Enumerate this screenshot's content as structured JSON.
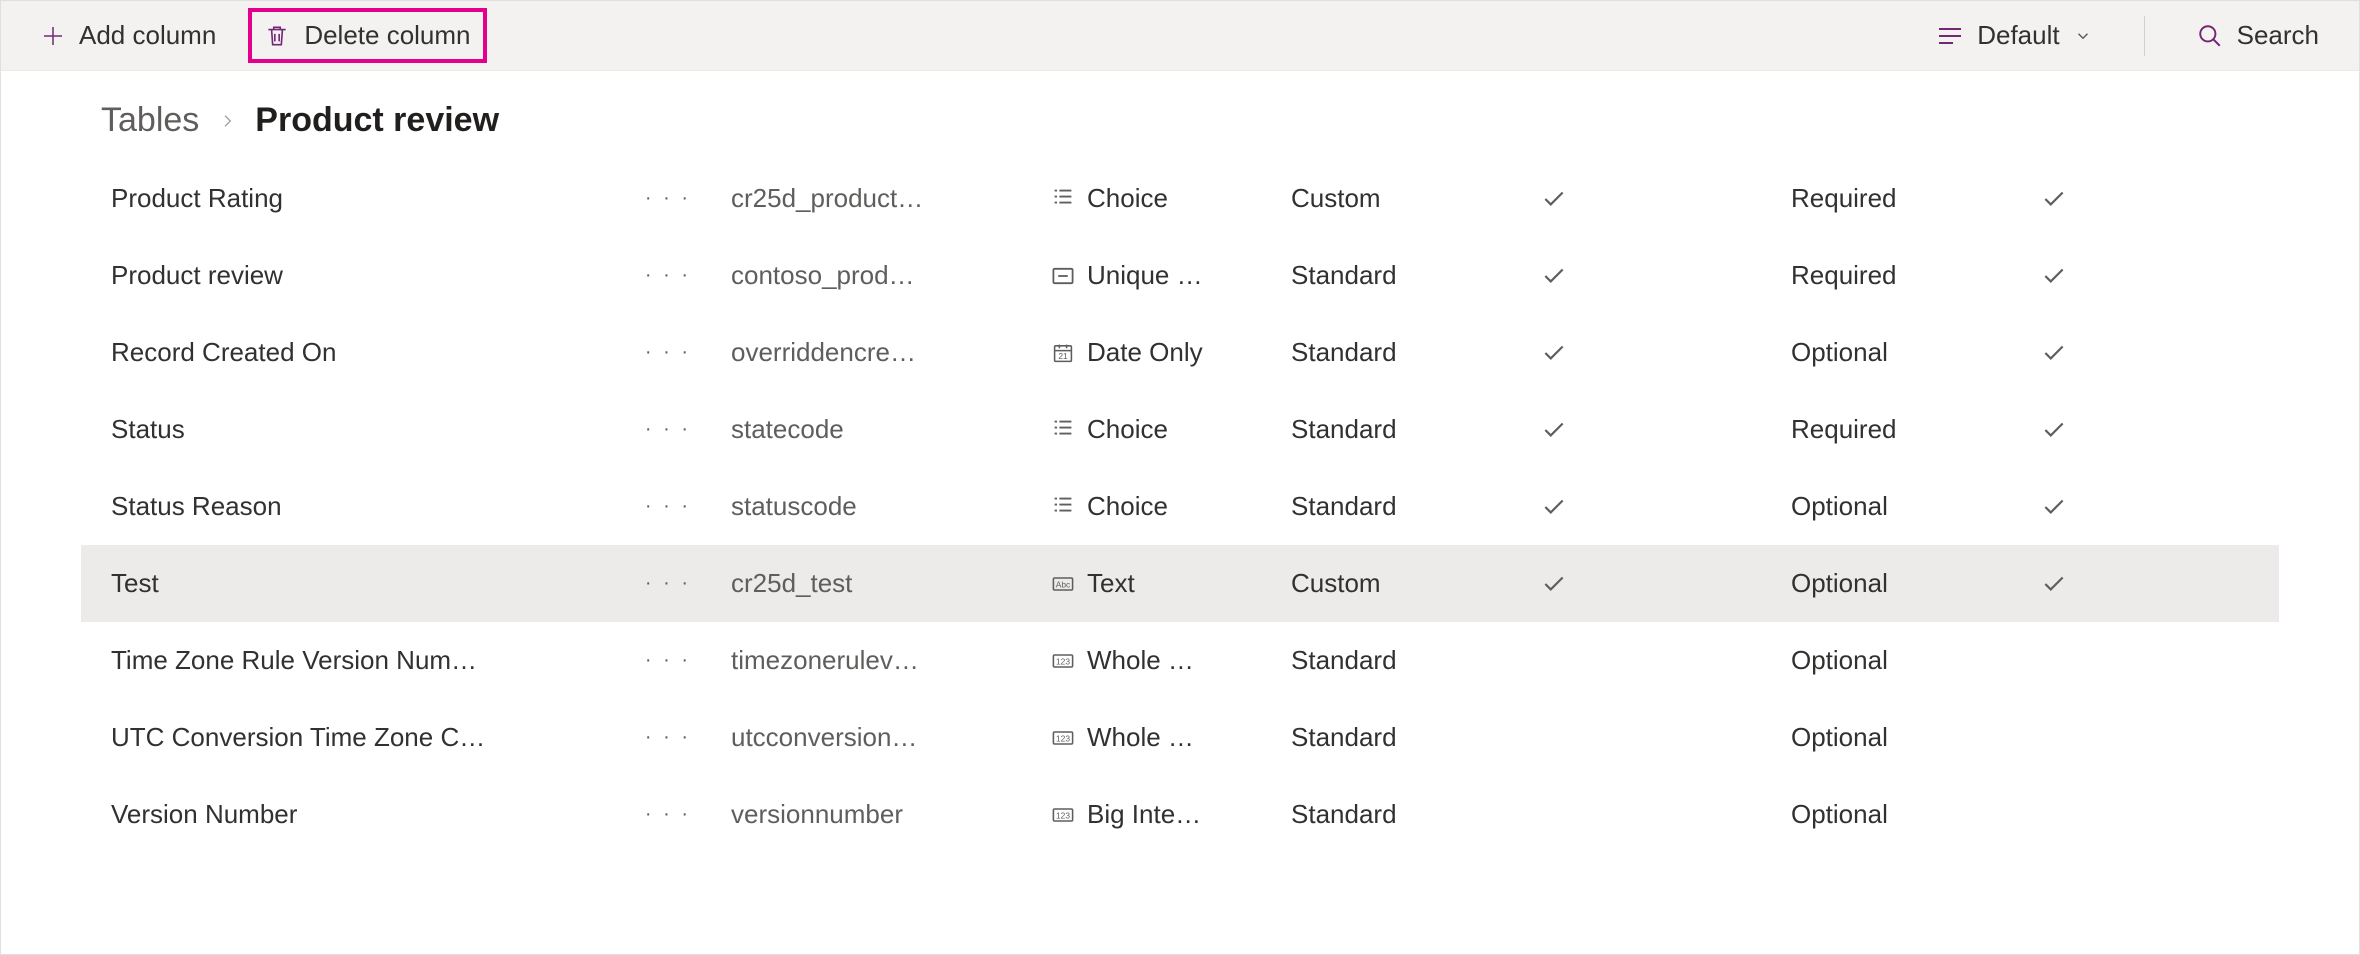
{
  "toolbar": {
    "add_label": "Add column",
    "delete_label": "Delete column",
    "view_label": "Default",
    "search_label": "Search"
  },
  "breadcrumb": {
    "root": "Tables",
    "current": "Product review"
  },
  "rows": [
    {
      "display": "Product Rating",
      "name": "cr25d_product…",
      "type": "Choice",
      "kind": "Custom",
      "c1": true,
      "req": "Required",
      "c2": true,
      "sel": false
    },
    {
      "display": "Product review",
      "name": "contoso_prod…",
      "type": "Unique …",
      "kind": "Standard",
      "c1": true,
      "req": "Required",
      "c2": true,
      "sel": false
    },
    {
      "display": "Record Created On",
      "name": "overriddencre…",
      "type": "Date Only",
      "kind": "Standard",
      "c1": true,
      "req": "Optional",
      "c2": true,
      "sel": false
    },
    {
      "display": "Status",
      "name": "statecode",
      "type": "Choice",
      "kind": "Standard",
      "c1": true,
      "req": "Required",
      "c2": true,
      "sel": false
    },
    {
      "display": "Status Reason",
      "name": "statuscode",
      "type": "Choice",
      "kind": "Standard",
      "c1": true,
      "req": "Optional",
      "c2": true,
      "sel": false
    },
    {
      "display": "Test",
      "name": "cr25d_test",
      "type": "Text",
      "kind": "Custom",
      "c1": true,
      "req": "Optional",
      "c2": true,
      "sel": true
    },
    {
      "display": "Time Zone Rule Version Num…",
      "name": "timezonerulev…",
      "type": "Whole …",
      "kind": "Standard",
      "c1": false,
      "req": "Optional",
      "c2": false,
      "sel": false
    },
    {
      "display": "UTC Conversion Time Zone C…",
      "name": "utcconversion…",
      "type": "Whole …",
      "kind": "Standard",
      "c1": false,
      "req": "Optional",
      "c2": false,
      "sel": false
    },
    {
      "display": "Version Number",
      "name": "versionnumber",
      "type": "Big Inte…",
      "kind": "Standard",
      "c1": false,
      "req": "Optional",
      "c2": false,
      "sel": false
    }
  ]
}
